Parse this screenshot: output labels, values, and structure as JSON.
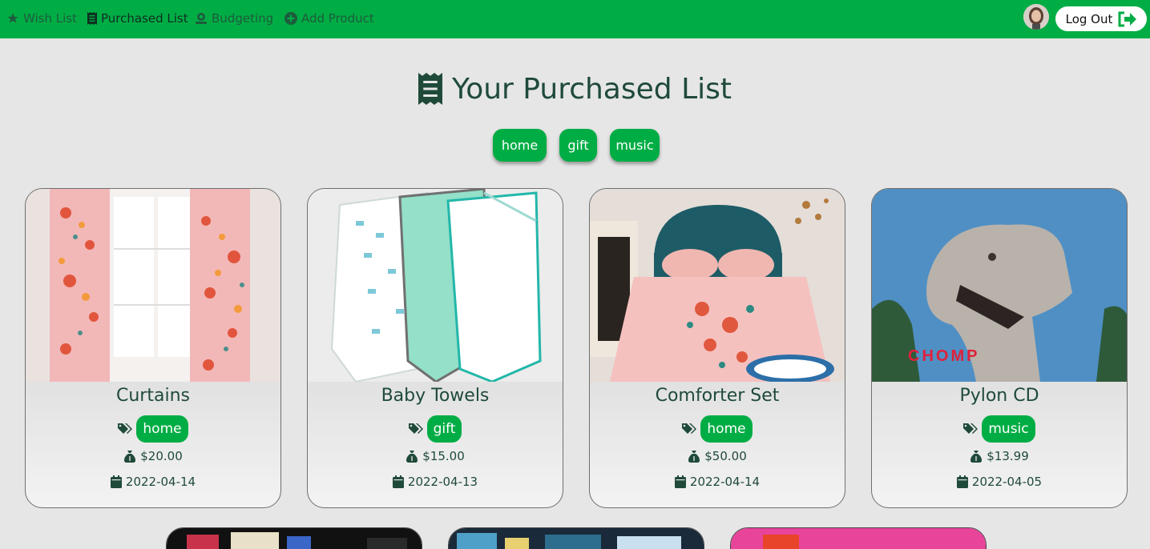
{
  "nav": {
    "items": [
      {
        "label": "Wish List"
      },
      {
        "label": "Purchased List"
      },
      {
        "label": "Budgeting"
      },
      {
        "label": "Add Product"
      }
    ],
    "logout_label": "Log Out"
  },
  "page": {
    "title": "Your Purchased List",
    "filters": [
      "home",
      "gift",
      "music"
    ]
  },
  "products": [
    {
      "name": "Curtains",
      "tag": "home",
      "price": "$20.00",
      "date": "2022-04-14"
    },
    {
      "name": "Baby Towels",
      "tag": "gift",
      "price": "$15.00",
      "date": "2022-04-13"
    },
    {
      "name": "Comforter Set",
      "tag": "home",
      "price": "$50.00",
      "date": "2022-04-14"
    },
    {
      "name": "Pylon CD",
      "tag": "music",
      "price": "$13.99",
      "date": "2022-04-05"
    }
  ],
  "product_images": {
    "pylon_cover_text": "CHOMP"
  },
  "colors": {
    "nav_green": "#00ad45",
    "background": "#e6e6e6",
    "text_dark_green": "#1f4a3a"
  }
}
